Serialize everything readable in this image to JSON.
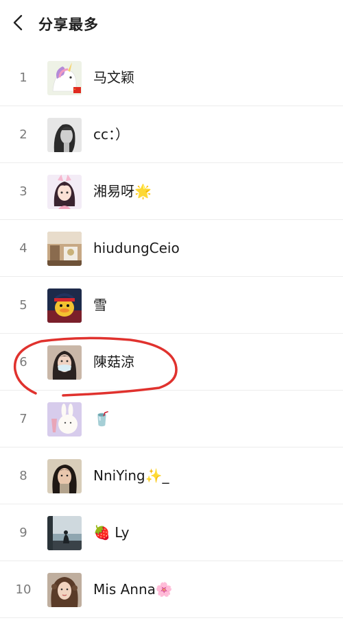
{
  "header": {
    "title": "分享最多",
    "back_icon": "chevron-left-icon"
  },
  "users": [
    {
      "rank": "1",
      "name": "马文颖",
      "avatar": "unicorn-avatar"
    },
    {
      "rank": "2",
      "name": "cc：）",
      "avatar": "bw-portrait-avatar"
    },
    {
      "rank": "3",
      "name": "湘易呀🌟",
      "avatar": "cartoon-girl-avatar"
    },
    {
      "rank": "4",
      "name": "hiudungCeio",
      "avatar": "room-photo-avatar"
    },
    {
      "rank": "5",
      "name": "雪",
      "avatar": "cartoon-duck-avatar"
    },
    {
      "rank": "6",
      "name": "陳菇涼",
      "avatar": "masked-girl-avatar"
    },
    {
      "rank": "7",
      "name": "🥤",
      "avatar": "bunny-drawing-avatar"
    },
    {
      "rank": "8",
      "name": "NniYing✨_",
      "avatar": "girl-selfie-avatar"
    },
    {
      "rank": "9",
      "name": "🍓 Ly",
      "avatar": "seaside-silhouette-avatar"
    },
    {
      "rank": "10",
      "name": "Mis Anna🌸",
      "avatar": "curly-hair-girl-avatar"
    }
  ],
  "annotation": {
    "circled_rank": "6",
    "color": "#e0322e"
  },
  "colors": {
    "rank_text": "#7a7a7a",
    "divider": "#ececec"
  }
}
